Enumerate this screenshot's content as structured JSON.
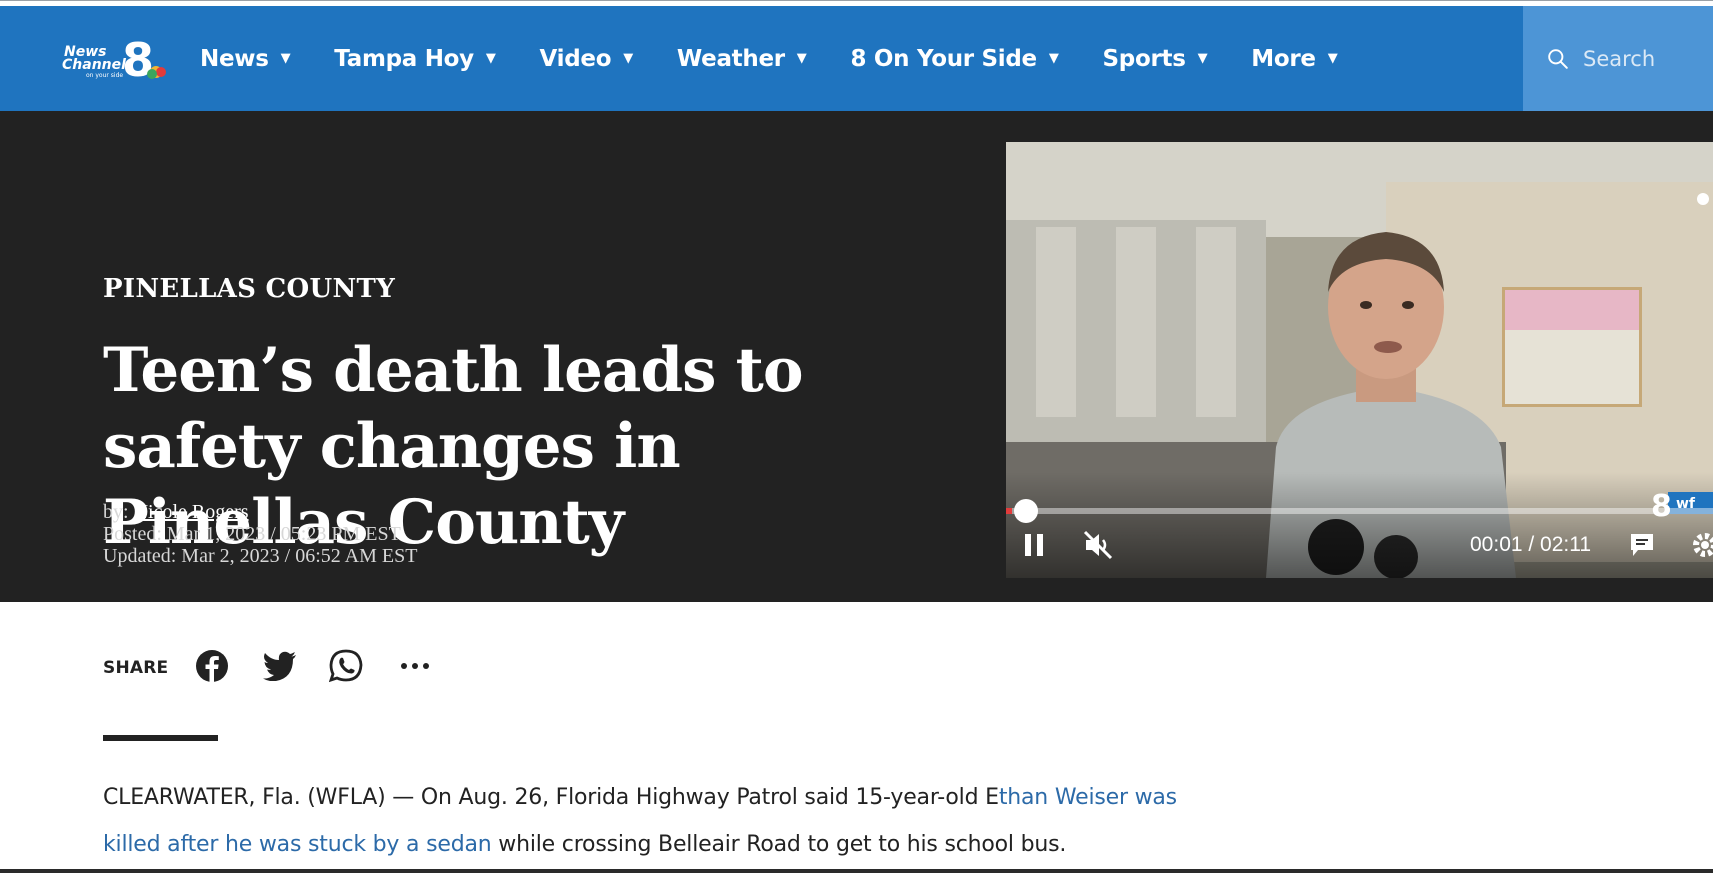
{
  "site": {
    "logo_alt": "News Channel 8 on your side",
    "brand_color": "#1f74bf"
  },
  "nav": {
    "items": [
      {
        "label": "News",
        "icon": "caret-down-icon"
      },
      {
        "label": "Tampa Hoy",
        "icon": "caret-down-icon"
      },
      {
        "label": "Video",
        "icon": "caret-down-icon"
      },
      {
        "label": "Weather",
        "icon": "caret-down-icon"
      },
      {
        "label": "8 On Your Side",
        "icon": "caret-down-icon"
      },
      {
        "label": "Sports",
        "icon": "caret-down-icon"
      },
      {
        "label": "More",
        "icon": "caret-down-icon"
      }
    ],
    "search_placeholder": "Search"
  },
  "article": {
    "category": "PINELLAS COUNTY",
    "headline": "Teen’s death leads to safety changes in Pinellas County",
    "by_prefix": "by:",
    "author": "Nicole Rogers",
    "posted": "Posted: Mar 1, 2023 / 05:23 PM EST",
    "updated": "Updated: Mar 2, 2023 / 06:52 AM EST",
    "body_part1": "CLEARWATER, Fla. (WFLA) — On Aug. 26, Florida Highway Patrol said 15-year-old E",
    "body_link": "than Weiser was killed after he was stuck by a sedan",
    "body_part2": " while crossing Belleair Road to get to his school bus."
  },
  "video": {
    "time": "00:01 / 02:11",
    "progress": 0.008,
    "state": "playing",
    "muted": true
  },
  "share": {
    "label": "SHARE",
    "icons": [
      "facebook-icon",
      "twitter-icon",
      "whatsapp-icon",
      "more-icon"
    ]
  }
}
